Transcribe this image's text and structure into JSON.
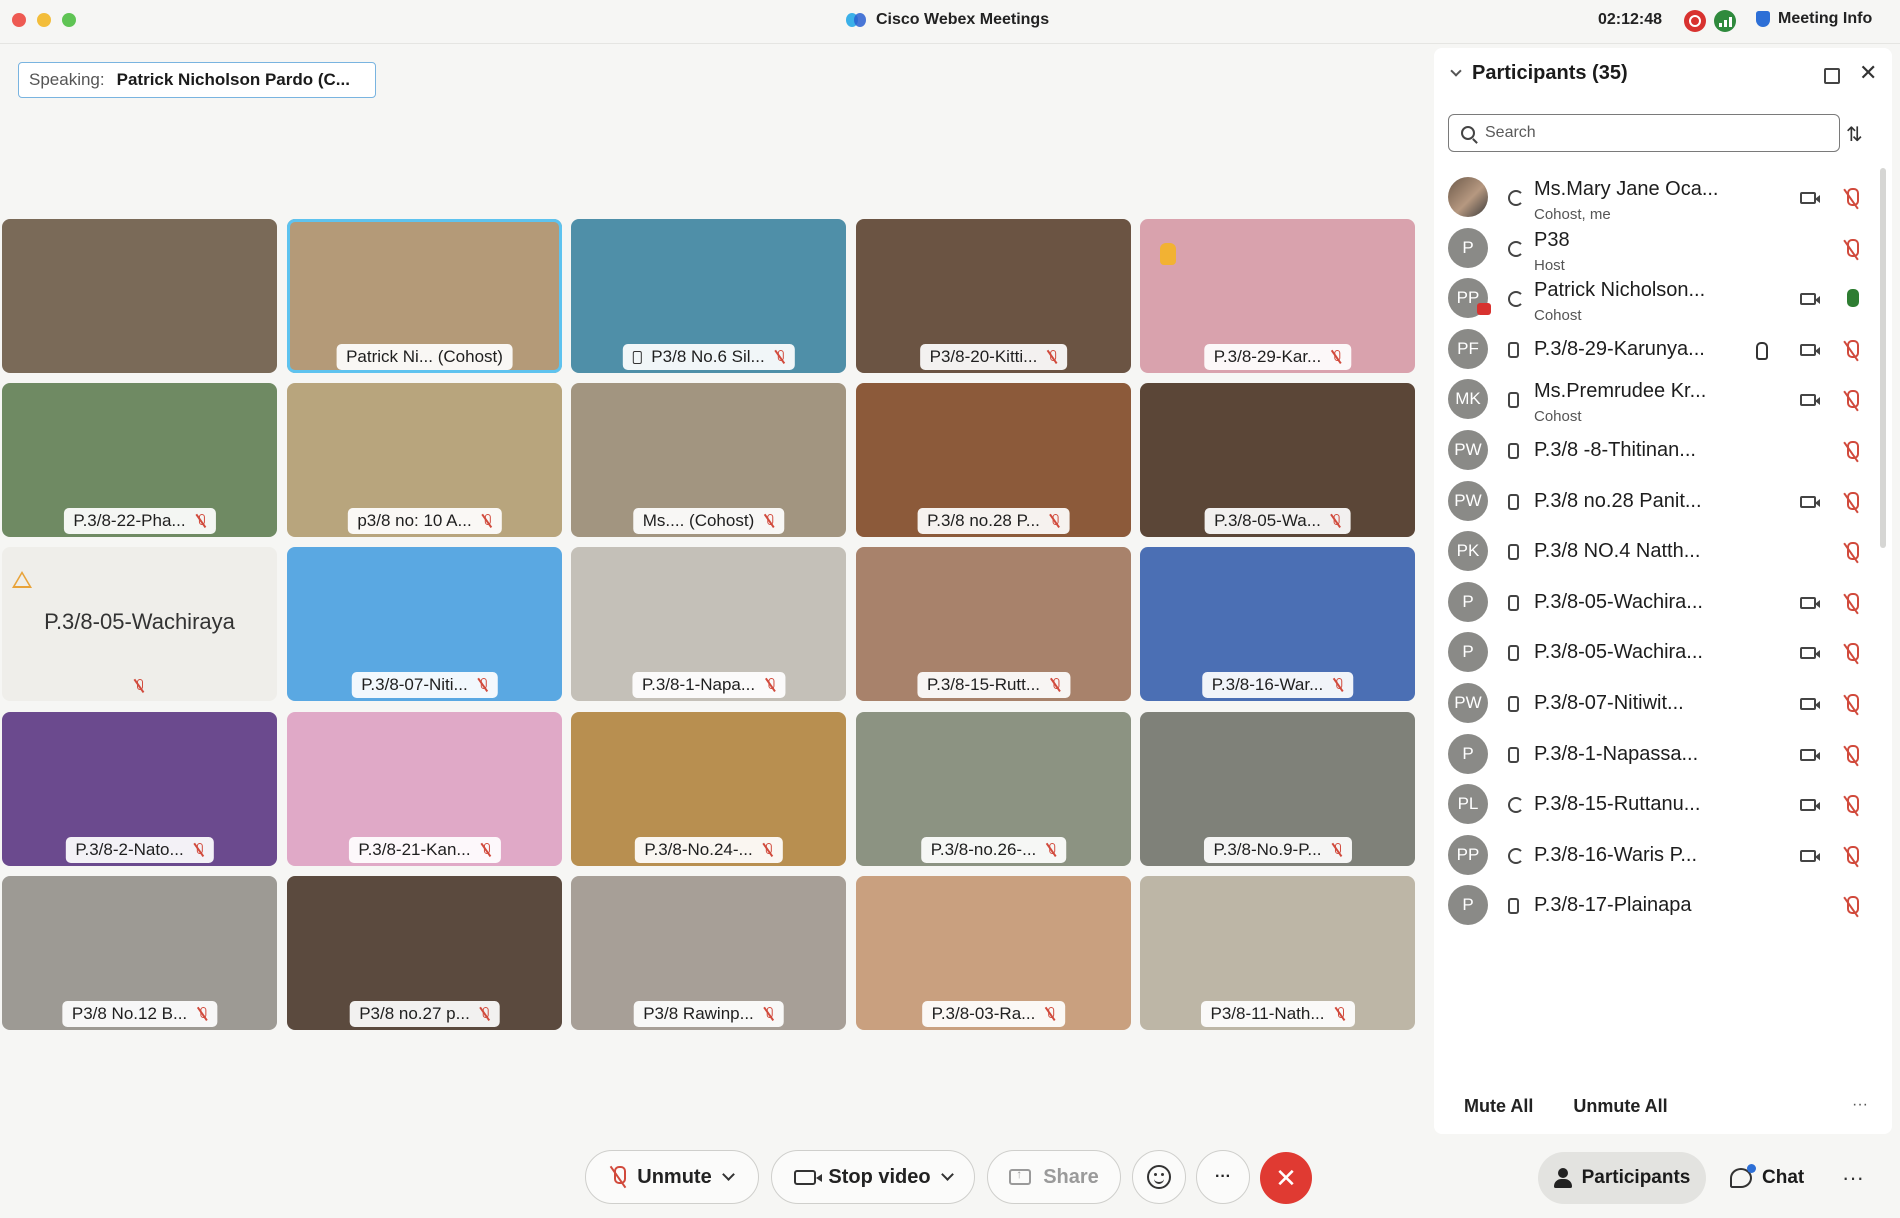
{
  "window": {
    "title": "Cisco Webex Meetings",
    "clock": "02:12:48",
    "meeting_info": "Meeting Info"
  },
  "speaking": {
    "label": "Speaking:",
    "name": "Patrick Nicholson Pardo (C..."
  },
  "tiles": [
    {
      "name": "",
      "bg": "#7a6a58",
      "show_tag": false
    },
    {
      "name": "Patrick Ni...   (Cohost)",
      "bg": "#b49a78",
      "active": true,
      "muted": false
    },
    {
      "name": "P3/8 No.6 Sil...",
      "bg": "#4f8fa8",
      "phone": true
    },
    {
      "name": "P3/8-20-Kitti...",
      "bg": "#6b5443"
    },
    {
      "name": "P.3/8-29-Kar...",
      "bg": "#d9a2ad",
      "hand": true
    },
    {
      "name": "P.3/8-22-Pha...",
      "bg": "#6f8a63"
    },
    {
      "name": "p3/8 no: 10 A...",
      "bg": "#b8a57d"
    },
    {
      "name": "Ms....   (Cohost)",
      "bg": "#a29580"
    },
    {
      "name": "P.3/8 no.28 P...",
      "bg": "#8c5a3a"
    },
    {
      "name": "P.3/8-05-Wa...",
      "bg": "#5b4637"
    },
    {
      "name": "P.3/8-05-Wachiraya",
      "bg": "#efeeea",
      "no_video": true
    },
    {
      "name": "P.3/8-07-Niti...",
      "bg": "#5aa8e2"
    },
    {
      "name": "P.3/8-1-Napa...",
      "bg": "#c4c0b8"
    },
    {
      "name": "P.3/8-15-Rutt...",
      "bg": "#a8826b"
    },
    {
      "name": "P.3/8-16-War...",
      "bg": "#4b6fb4"
    },
    {
      "name": "P.3/8-2-Nato...",
      "bg": "#6b4a8e"
    },
    {
      "name": "P.3/8-21-Kan...",
      "bg": "#e0a9c7"
    },
    {
      "name": "P.3/8-No.24-...",
      "bg": "#b88f50"
    },
    {
      "name": "P.3/8-no.26-...",
      "bg": "#8c9382"
    },
    {
      "name": "P.3/8-No.9-P...",
      "bg": "#7f8179"
    },
    {
      "name": "P3/8 No.12 B...",
      "bg": "#9d9a94"
    },
    {
      "name": "P3/8 no.27 p...",
      "bg": "#5b4a3e"
    },
    {
      "name": "P3/8 Rawinp...",
      "bg": "#a79f97"
    },
    {
      "name": "P.3/8-03-Ra...",
      "bg": "#c9a07f"
    },
    {
      "name": "P3/8-11-Nath...",
      "bg": "#bdb6a6"
    }
  ],
  "toolbar": {
    "unmute": "Unmute",
    "stop_video": "Stop video",
    "share": "Share",
    "more": "···",
    "end": "✕"
  },
  "panel": {
    "title": "Participants (35)",
    "search_placeholder": "Search",
    "mute_all": "Mute All",
    "unmute_all": "Unmute All",
    "more": "···",
    "participants_button": "Participants",
    "chat_button": "Chat",
    "bottom_more": "···",
    "list": [
      {
        "initials": "",
        "photo": true,
        "device": "sync",
        "name": "Ms.Mary Jane Oca...",
        "role": "Cohost, me",
        "cam": true,
        "mic": "muted"
      },
      {
        "initials": "P",
        "device": "sync",
        "name": "P38",
        "role": "Host",
        "cam": false,
        "mic": "muted"
      },
      {
        "initials": "PP",
        "badge": true,
        "device": "sync",
        "name": "Patrick Nicholson...",
        "role": "Cohost",
        "cam": true,
        "mic": "on"
      },
      {
        "initials": "PF",
        "device": "phone",
        "name": "P.3/8-29-Karunya...",
        "role": "",
        "hand": true,
        "cam": true,
        "mic": "muted"
      },
      {
        "initials": "MK",
        "device": "phone",
        "name": "Ms.Premrudee Kr...",
        "role": "Cohost",
        "cam": true,
        "mic": "muted"
      },
      {
        "initials": "PW",
        "device": "phone",
        "name": " P.3/8 -8-Thitinan...",
        "role": "",
        "cam": false,
        "mic": "muted"
      },
      {
        "initials": "PW",
        "device": "phone",
        "name": "P.3/8 no.28 Panit...",
        "role": "",
        "cam": true,
        "mic": "muted"
      },
      {
        "initials": "PK",
        "device": "phone",
        "name": "P.3/8 NO.4 Natth...",
        "role": "",
        "cam": false,
        "mic": "muted"
      },
      {
        "initials": "P",
        "device": "phone",
        "name": "P.3/8-05-Wachira...",
        "role": "",
        "cam": true,
        "mic": "muted"
      },
      {
        "initials": "P",
        "device": "phone",
        "name": "P.3/8-05-Wachira...",
        "role": "",
        "cam": true,
        "mic": "muted"
      },
      {
        "initials": "PW",
        "device": "phone",
        "name": "P.3/8-07-Nitiwit...",
        "role": "",
        "cam": true,
        "mic": "muted"
      },
      {
        "initials": "P",
        "device": "phone",
        "name": "P.3/8-1-Napassa...",
        "role": "",
        "cam": true,
        "mic": "muted"
      },
      {
        "initials": "PL",
        "device": "sync",
        "name": "P.3/8-15-Ruttanu...",
        "role": "",
        "cam": true,
        "mic": "muted"
      },
      {
        "initials": "PP",
        "device": "sync",
        "name": "P.3/8-16-Waris P...",
        "role": "",
        "cam": true,
        "mic": "muted"
      },
      {
        "initials": "P",
        "device": "phone",
        "name": "P.3/8-17-Plainapa",
        "role": "",
        "cam": false,
        "mic": "muted"
      }
    ]
  }
}
